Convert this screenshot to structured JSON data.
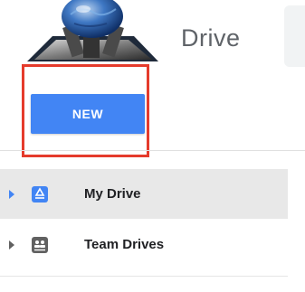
{
  "header": {
    "app_title": "Drive"
  },
  "new_button": {
    "label": "NEW"
  },
  "sidebar": {
    "items": [
      {
        "label": "My Drive",
        "icon": "my-drive-icon",
        "active": true
      },
      {
        "label": "Team Drives",
        "icon": "team-drives-icon",
        "active": false
      }
    ]
  },
  "colors": {
    "accent": "#4285f4",
    "highlight": "#e53b2c",
    "active_bg": "#e8e8e8"
  }
}
